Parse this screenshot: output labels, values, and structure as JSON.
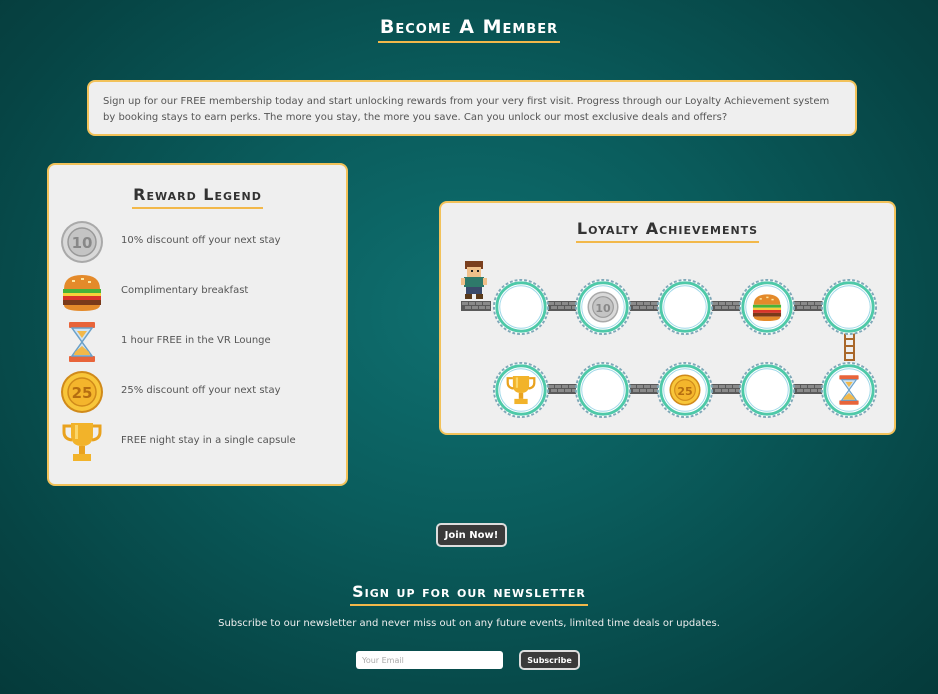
{
  "page_title": "Become A Member",
  "intro_text": "Sign up for our FREE membership today and start unlocking rewards from your very first visit. Progress through our Loyalty Achievement system by booking stays to earn perks. The more you stay, the more you save. Can you unlock our most exclusive deals and offers?",
  "legend": {
    "title": "Reward Legend",
    "items": [
      {
        "icon": "coin-10-icon",
        "coin_label": "10",
        "text": "10% discount off your next stay"
      },
      {
        "icon": "burger-icon",
        "text": "Complimentary breakfast"
      },
      {
        "icon": "hourglass-icon",
        "text": "1 hour FREE in the VR Lounge"
      },
      {
        "icon": "coin-25-icon",
        "coin_label": "25",
        "text": "25% discount off your next stay"
      },
      {
        "icon": "trophy-icon",
        "text": "FREE night stay in a single capsule"
      }
    ]
  },
  "achievements": {
    "title": "Loyalty Achievements",
    "coin_10_label": "10",
    "coin_25_label": "25"
  },
  "join_button": "Join Now!",
  "newsletter": {
    "title": "Sign up for our newsletter",
    "text": "Subscribe to our newsletter and never miss out on any future events, limited time deals or updates.",
    "email_placeholder": "Your Email",
    "subscribe_label": "Subscribe"
  },
  "colors": {
    "accent": "#f2b84a",
    "background": "#0a5c5c",
    "card": "#efefef",
    "ring": "#4ec9a8"
  }
}
